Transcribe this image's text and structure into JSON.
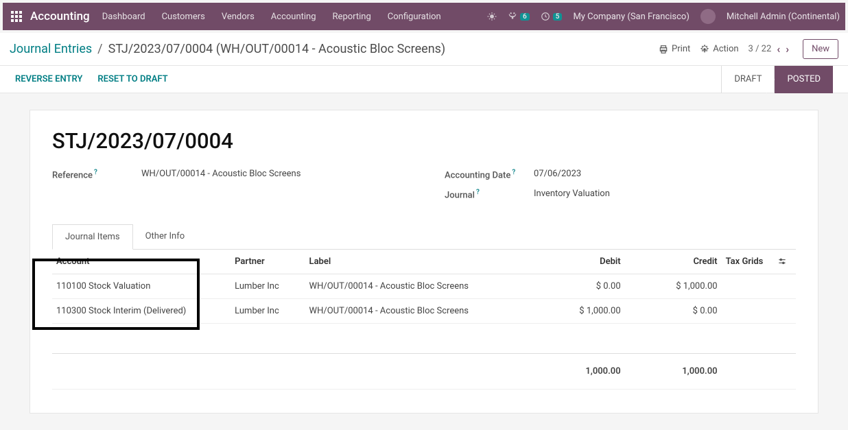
{
  "nav": {
    "brand": "Accounting",
    "items": [
      "Dashboard",
      "Customers",
      "Vendors",
      "Accounting",
      "Reporting",
      "Configuration"
    ],
    "msg_count": "6",
    "activity_count": "5",
    "company": "My Company (San Francisco)",
    "user": "Mitchell Admin (Continental)"
  },
  "breadcrumb": {
    "parent": "Journal Entries",
    "sep": "/",
    "current": "STJ/2023/07/0004 (WH/OUT/00014 - Acoustic Bloc Screens)",
    "print": "Print",
    "action": "Action",
    "pager": "3 / 22",
    "new": "New"
  },
  "statusbar": {
    "reverse": "REVERSE ENTRY",
    "reset": "RESET TO DRAFT",
    "draft": "DRAFT",
    "posted": "POSTED"
  },
  "doc": {
    "title": "STJ/2023/07/0004",
    "ref_label": "Reference",
    "ref_value": "WH/OUT/00014 - Acoustic Bloc Screens",
    "date_label": "Accounting Date",
    "date_value": "07/06/2023",
    "journal_label": "Journal",
    "journal_value": "Inventory Valuation",
    "tab1": "Journal Items",
    "tab2": "Other Info"
  },
  "table": {
    "headers": {
      "account": "Account",
      "partner": "Partner",
      "label": "Label",
      "debit": "Debit",
      "credit": "Credit",
      "tax": "Tax Grids"
    },
    "rows": [
      {
        "account": "110100 Stock Valuation",
        "partner": "Lumber Inc",
        "label": "WH/OUT/00014 - Acoustic Bloc Screens",
        "debit": "$ 0.00",
        "credit": "$ 1,000.00"
      },
      {
        "account": "110300 Stock Interim (Delivered)",
        "partner": "Lumber Inc",
        "label": "WH/OUT/00014 - Acoustic Bloc Screens",
        "debit": "$ 1,000.00",
        "credit": "$ 0.00"
      }
    ],
    "totals": {
      "debit": "1,000.00",
      "credit": "1,000.00"
    }
  }
}
